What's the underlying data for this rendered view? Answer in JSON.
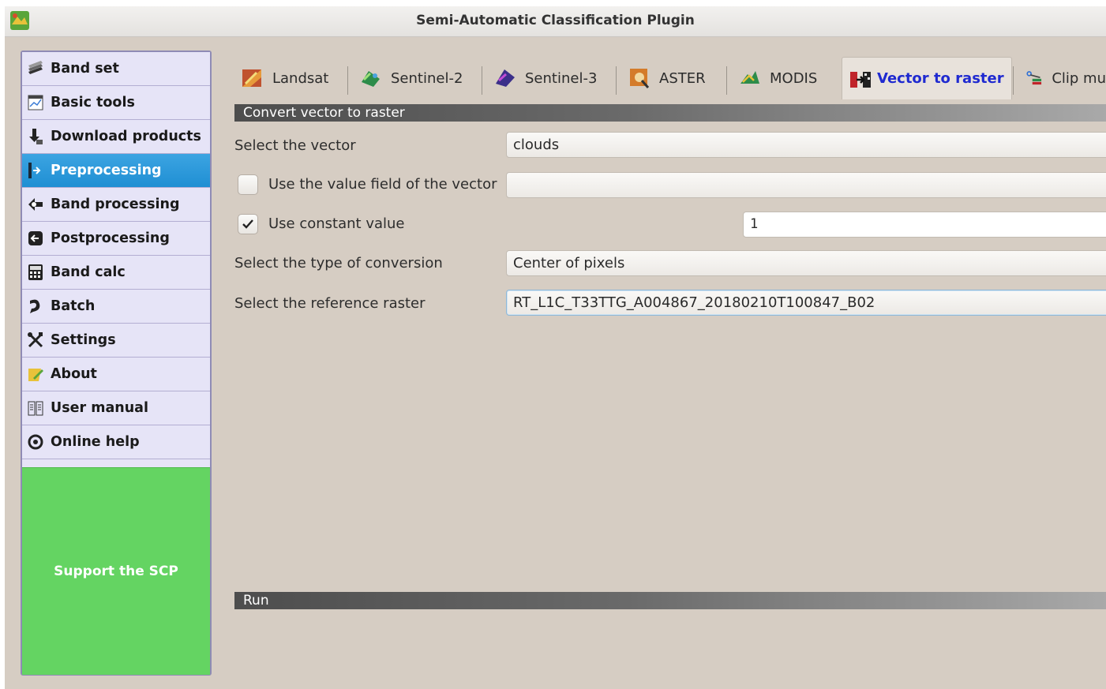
{
  "window": {
    "title": "Semi-Automatic Classification Plugin"
  },
  "sidebar": {
    "items": [
      {
        "label": "Band set",
        "icon": "band-set-icon"
      },
      {
        "label": "Basic tools",
        "icon": "basic-tools-icon"
      },
      {
        "label": "Download products",
        "icon": "download-icon"
      },
      {
        "label": "Preprocessing",
        "icon": "preprocessing-icon",
        "active": true
      },
      {
        "label": "Band processing",
        "icon": "band-processing-icon"
      },
      {
        "label": "Postprocessing",
        "icon": "postprocessing-icon"
      },
      {
        "label": "Band calc",
        "icon": "calculator-icon"
      },
      {
        "label": "Batch",
        "icon": "batch-icon"
      },
      {
        "label": "Settings",
        "icon": "settings-icon"
      },
      {
        "label": "About",
        "icon": "about-icon"
      },
      {
        "label": "User manual",
        "icon": "book-icon"
      },
      {
        "label": "Online help",
        "icon": "help-icon"
      }
    ],
    "support_label": "Support the SCP"
  },
  "tabs": [
    {
      "label": "Landsat",
      "icon": "landsat-icon"
    },
    {
      "label": "Sentinel-2",
      "icon": "sentinel-2-icon"
    },
    {
      "label": "Sentinel-3",
      "icon": "sentinel-3-icon"
    },
    {
      "label": "ASTER",
      "icon": "aster-icon"
    },
    {
      "label": "MODIS",
      "icon": "modis-icon"
    },
    {
      "label": "Vector to raster",
      "icon": "vector-to-raster-icon",
      "active": true
    },
    {
      "label": "Clip mu",
      "icon": "clip-icon"
    }
  ],
  "form": {
    "section_title": "Convert vector to raster",
    "vector_label": "Select the vector",
    "vector_value": "clouds",
    "use_field_label": "Use the value field of the vector",
    "use_field_checked": false,
    "use_field_value": "",
    "use_constant_label": "Use constant value",
    "use_constant_checked": true,
    "constant_value": "1",
    "conversion_label": "Select the type of conversion",
    "conversion_value": "Center of pixels",
    "reference_label": "Select the reference raster",
    "reference_value": "RT_L1C_T33TTG_A004867_20180210T100847_B02"
  },
  "run": {
    "section_title": "Run"
  },
  "colors": {
    "active_sidebar": "#1f8fd3",
    "support_green": "#64d462",
    "active_tab_text": "#1f2ad0",
    "background": "#d6cdc3"
  }
}
